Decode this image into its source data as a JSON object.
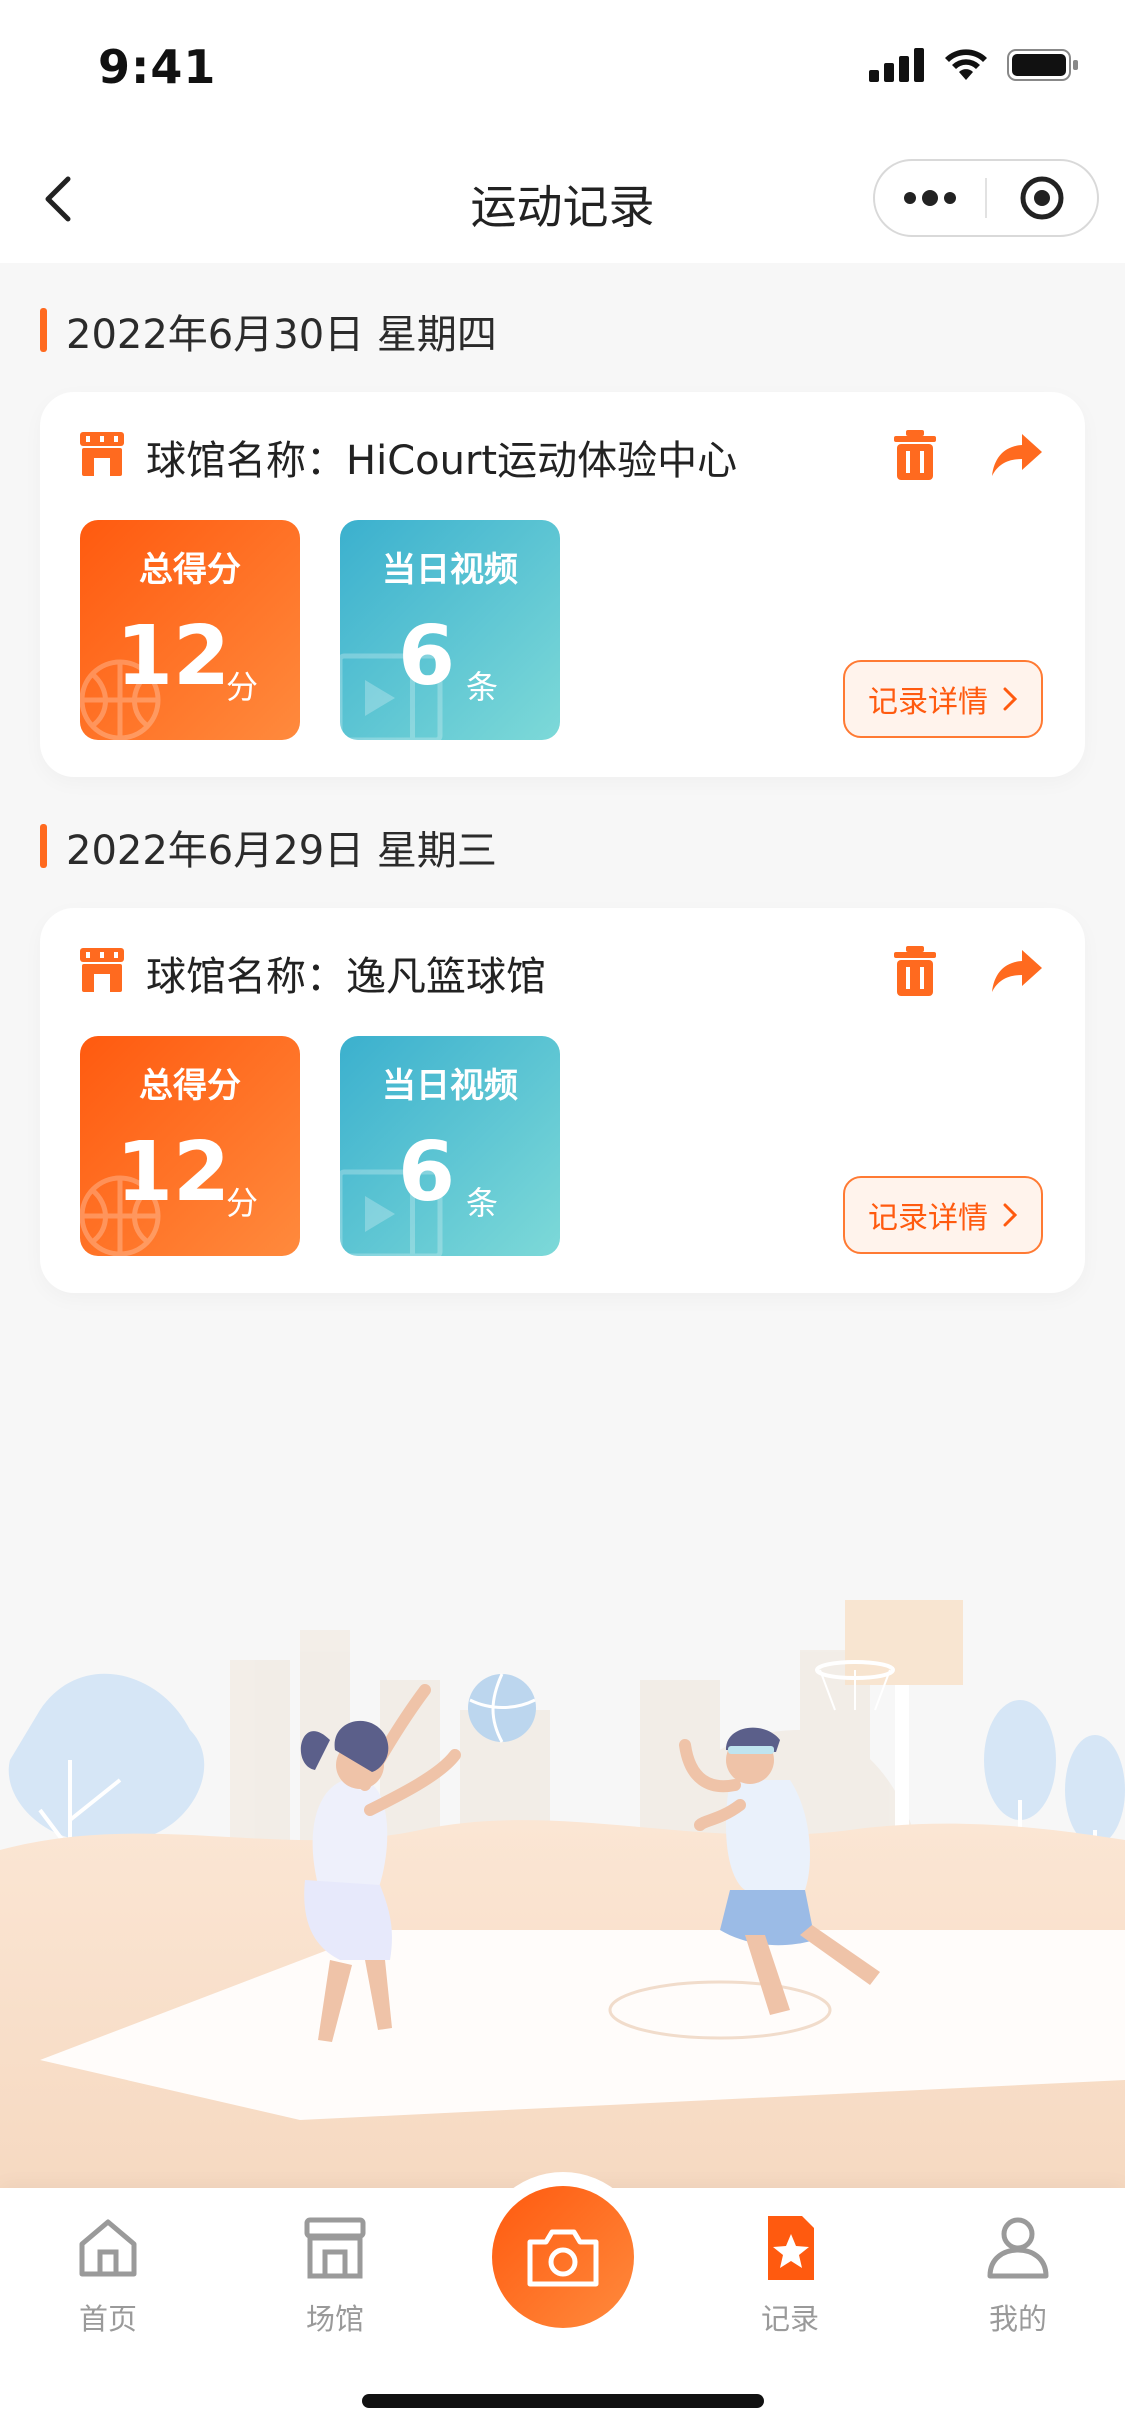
{
  "status_bar": {
    "time": "9:41"
  },
  "nav": {
    "title": "运动记录",
    "capsule": {
      "more_icon": "more-dots-icon",
      "close_icon": "target-close-icon"
    }
  },
  "colors": {
    "accent": "#ff5a0f",
    "score_tile": "#ff6a1f",
    "video_tile": "#47b9d2",
    "background": "#f7f7f7"
  },
  "records": [
    {
      "date": "2022年6月30日 星期四",
      "venue_label": "球馆名称：",
      "venue_name": "HiCourt运动体验中心",
      "score": {
        "label": "总得分",
        "value": "12",
        "unit": "分"
      },
      "videos": {
        "label": "当日视频",
        "value": "6",
        "unit": "条"
      },
      "detail_label": "记录详情"
    },
    {
      "date": "2022年6月29日 星期三",
      "venue_label": "球馆名称：",
      "venue_name": "逸凡篮球馆",
      "score": {
        "label": "总得分",
        "value": "12",
        "unit": "分"
      },
      "videos": {
        "label": "当日视频",
        "value": "6",
        "unit": "条"
      },
      "detail_label": "记录详情"
    }
  ],
  "tabs": [
    {
      "label": "首页",
      "icon": "home-icon",
      "active": false
    },
    {
      "label": "场馆",
      "icon": "venue-store-icon",
      "active": false
    },
    {
      "label": "",
      "icon": "camera-icon",
      "active": false
    },
    {
      "label": "记录",
      "icon": "record-star-icon",
      "active": true
    },
    {
      "label": "我的",
      "icon": "profile-icon",
      "active": false
    }
  ]
}
